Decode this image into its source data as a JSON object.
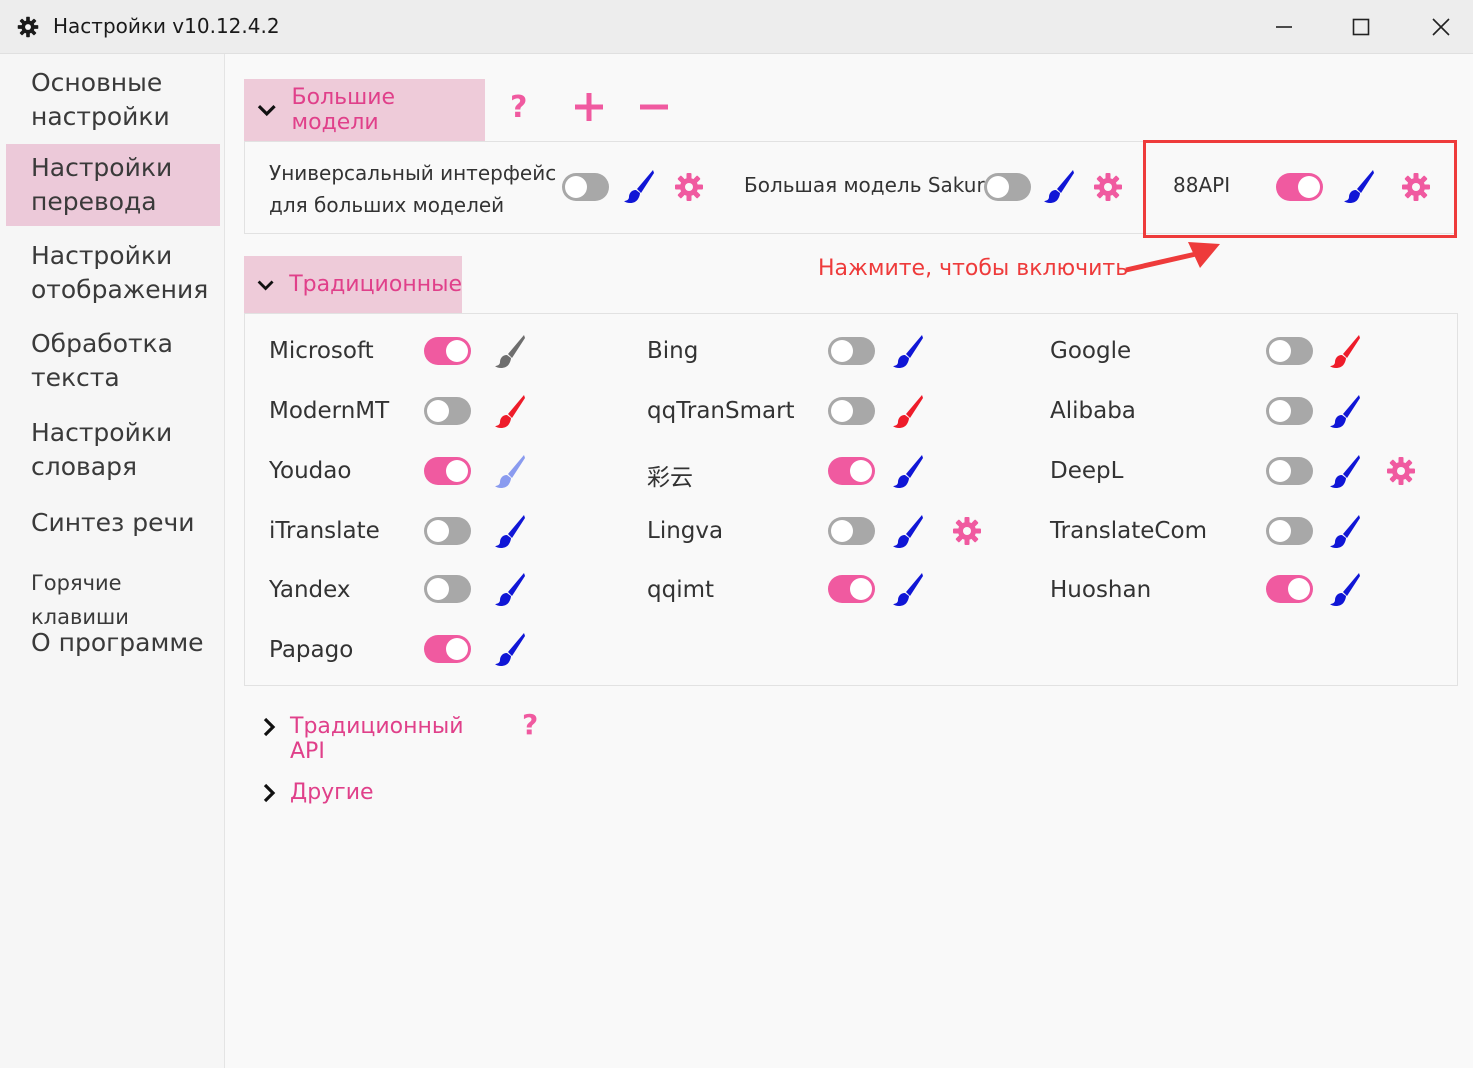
{
  "window": {
    "title": "Настройки v10.12.4.2",
    "icons": {
      "app": "gear-icon",
      "minimize": "minimize-icon",
      "maximize": "maximize-icon",
      "close": "close-icon"
    }
  },
  "sidebar": {
    "items": [
      {
        "label_line1": "Основные",
        "label_line2": "настройки"
      },
      {
        "label_line1": "Настройки",
        "label_line2": "перевода",
        "active": true
      },
      {
        "label_line1": "Настройки",
        "label_line2": "отображения"
      },
      {
        "label_line1": "Обработка",
        "label_line2": "текста"
      },
      {
        "label_line1": "Настройки",
        "label_line2": "словаря"
      },
      {
        "label_line1": "Синтез речи"
      },
      {
        "label_line1": "Горячие клавиши"
      },
      {
        "label_line1": "О программе"
      }
    ]
  },
  "sections": {
    "llm": {
      "title": "Большие модели",
      "expanded": true,
      "actions": {
        "help": "?",
        "add": "+",
        "remove": "−"
      },
      "items": [
        {
          "line1": "Универсальный интерфейс",
          "line2": "для больших моделей",
          "enabled": false,
          "brush_color": "#1016d6",
          "has_settings": true
        },
        {
          "name": "Большая модель Sakura",
          "enabled": false,
          "brush_color": "#1016d6",
          "has_settings": true
        },
        {
          "name": "88API",
          "enabled": true,
          "brush_color": "#1016d6",
          "has_settings": true
        }
      ]
    },
    "traditional": {
      "title": "Традиционные",
      "expanded": true,
      "items": [
        {
          "name": "Microsoft",
          "enabled": true,
          "brush_color": "#6e6e6e"
        },
        {
          "name": "Bing",
          "enabled": false,
          "brush_color": "#1016d6"
        },
        {
          "name": "Google",
          "enabled": false,
          "brush_color": "#ee1c2a"
        },
        {
          "name": "ModernMT",
          "enabled": false,
          "brush_color": "#ee1c2a"
        },
        {
          "name": "qqTranSmart",
          "enabled": false,
          "brush_color": "#ee1c2a"
        },
        {
          "name": "Alibaba",
          "enabled": false,
          "brush_color": "#1016d6"
        },
        {
          "name": "Youdao",
          "enabled": true,
          "brush_color": "#8a9bef"
        },
        {
          "name": "彩云",
          "enabled": true,
          "brush_color": "#1016d6"
        },
        {
          "name": "DeepL",
          "enabled": false,
          "brush_color": "#1016d6",
          "has_settings": true
        },
        {
          "name": "iTranslate",
          "enabled": false,
          "brush_color": "#1016d6"
        },
        {
          "name": "Lingva",
          "enabled": false,
          "brush_color": "#1016d6",
          "has_settings": true
        },
        {
          "name": "TranslateCom",
          "enabled": false,
          "brush_color": "#1016d6"
        },
        {
          "name": "Yandex",
          "enabled": false,
          "brush_color": "#1016d6"
        },
        {
          "name": "qqimt",
          "enabled": true,
          "brush_color": "#1016d6"
        },
        {
          "name": "Huoshan",
          "enabled": true,
          "brush_color": "#1016d6"
        },
        {
          "name": "Papago",
          "enabled": true,
          "brush_color": "#1016d6"
        }
      ]
    },
    "traditional_api": {
      "title": "Традиционный API",
      "expanded": false,
      "help": "?"
    },
    "others": {
      "title": "Другие",
      "expanded": false
    }
  },
  "annotation": {
    "text": "Нажмите, чтобы включить",
    "color": "#ee3b3b"
  },
  "colors": {
    "accent": "#e0408a",
    "toggle_on": "#f05aa0",
    "toggle_off": "#a8a8a8",
    "header_bg": "#eecbd9"
  }
}
